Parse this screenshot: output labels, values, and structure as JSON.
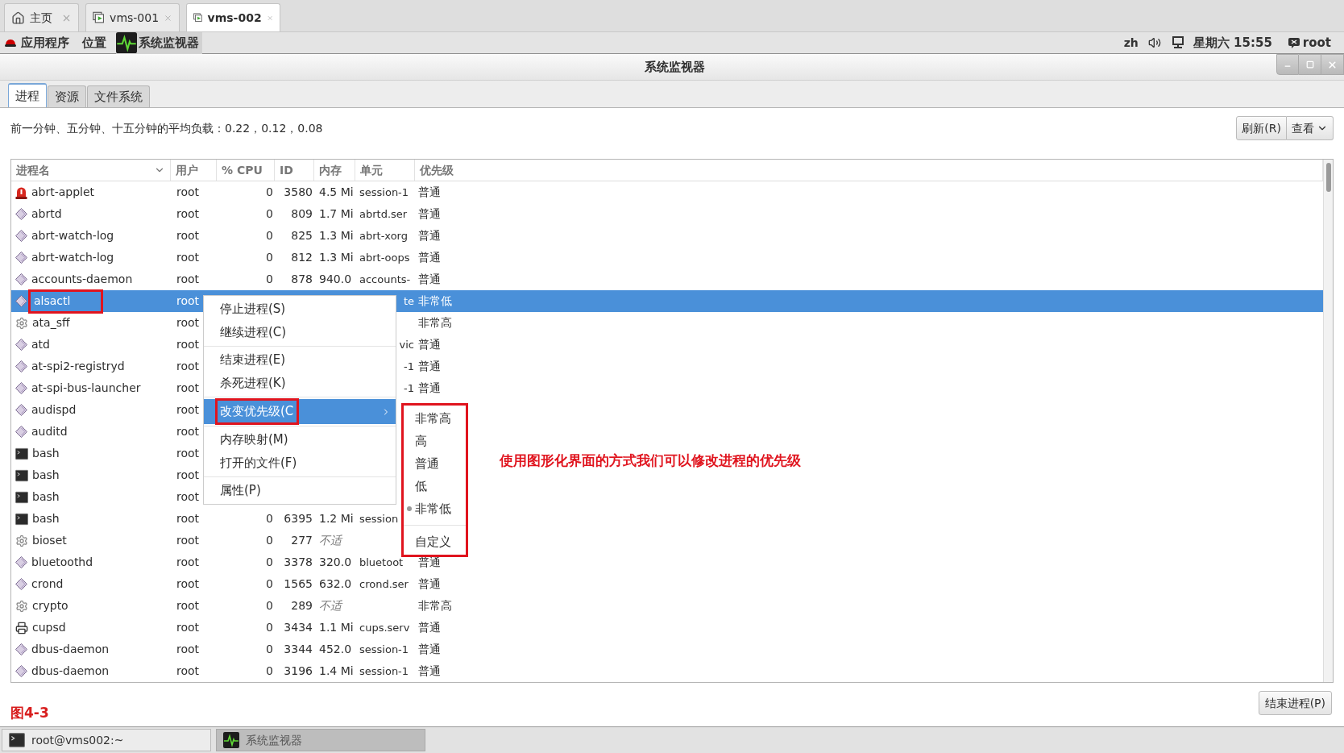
{
  "browser_tabs": [
    {
      "label": "主页",
      "kind": "home",
      "selected": false
    },
    {
      "label": "vms-001",
      "kind": "vm",
      "selected": false
    },
    {
      "label": "vms-002",
      "kind": "vm",
      "selected": true
    }
  ],
  "top_panel": {
    "applications": "应用程序",
    "places": "位置",
    "running_app": "系统监视器",
    "language": "zh",
    "clock": "星期六 15:55",
    "user": "root"
  },
  "window": {
    "title": "系统监视器"
  },
  "tabs": [
    {
      "label": "进程",
      "selected": true
    },
    {
      "label": "资源",
      "selected": false
    },
    {
      "label": "文件系统",
      "selected": false
    }
  ],
  "load_average": "前一分钟、五分钟、十五分钟的平均负载：0.22，0.12，0.08",
  "toolbar_buttons": [
    "刷新(R)",
    "查看"
  ],
  "table": {
    "columns": [
      "进程名",
      "用户",
      "% CPU",
      "ID",
      "内存",
      "单元",
      "优先级"
    ],
    "rows": [
      {
        "name": "abrt-applet",
        "kind": "alert",
        "user": "root",
        "cpu": "0",
        "id": "3580",
        "mem": "4.5 Mi",
        "unit": "session-1",
        "priority": "普通",
        "selected": false,
        "na": false,
        "highlighted": false
      },
      {
        "name": "abrtd",
        "kind": "diamond",
        "user": "root",
        "cpu": "0",
        "id": "809",
        "mem": "1.7 Mi",
        "unit": "abrtd.ser",
        "priority": "普通",
        "selected": false,
        "na": false,
        "highlighted": false
      },
      {
        "name": "abrt-watch-log",
        "kind": "diamond",
        "user": "root",
        "cpu": "0",
        "id": "825",
        "mem": "1.3 Mi",
        "unit": "abrt-xorg",
        "priority": "普通",
        "selected": false,
        "na": false,
        "highlighted": false
      },
      {
        "name": "abrt-watch-log",
        "kind": "diamond",
        "user": "root",
        "cpu": "0",
        "id": "812",
        "mem": "1.3 Mi",
        "unit": "abrt-oops",
        "priority": "普通",
        "selected": false,
        "na": false,
        "highlighted": false
      },
      {
        "name": "accounts-daemon",
        "kind": "diamond",
        "user": "root",
        "cpu": "0",
        "id": "878",
        "mem": "940.0",
        "unit": "accounts-",
        "priority": "普通",
        "selected": false,
        "na": false,
        "highlighted": false
      },
      {
        "name": "alsactl",
        "kind": "diamond",
        "user": "root",
        "unit": "te",
        "priority": "非常低",
        "selected": true,
        "highlighted": true
      },
      {
        "name": "ata_sff",
        "kind": "gear",
        "user": "root",
        "priority": "非常高",
        "selected": false,
        "highlighted": false
      },
      {
        "name": "atd",
        "kind": "diamond",
        "user": "root",
        "unit": "vic",
        "priority": "普通",
        "selected": false,
        "highlighted": false
      },
      {
        "name": "at-spi2-registryd",
        "kind": "diamond",
        "user": "root",
        "unit": "-1",
        "priority": "普通",
        "selected": false,
        "highlighted": false
      },
      {
        "name": "at-spi-bus-launcher",
        "kind": "diamond",
        "user": "root",
        "unit": "-1",
        "priority": "普通",
        "selected": false,
        "highlighted": false
      },
      {
        "name": "audispd",
        "kind": "diamond",
        "user": "root",
        "selected": false,
        "highlighted": false
      },
      {
        "name": "auditd",
        "kind": "diamond",
        "user": "root",
        "selected": false,
        "highlighted": false
      },
      {
        "name": "bash",
        "kind": "terminal",
        "user": "root",
        "selected": false,
        "highlighted": false
      },
      {
        "name": "bash",
        "kind": "terminal",
        "user": "root",
        "selected": false,
        "highlighted": false
      },
      {
        "name": "bash",
        "kind": "terminal",
        "user": "root",
        "selected": false,
        "highlighted": false
      },
      {
        "name": "bash",
        "kind": "terminal",
        "user": "root",
        "cpu": "0",
        "id": "6395",
        "mem": "1.2 Mi",
        "unit": "session",
        "selected": false,
        "na": false,
        "highlighted": false
      },
      {
        "name": "bioset",
        "kind": "gear",
        "user": "root",
        "cpu": "0",
        "id": "277",
        "mem": "不适",
        "selected": false,
        "na": true,
        "highlighted": false
      },
      {
        "name": "bluetoothd",
        "kind": "diamond",
        "user": "root",
        "cpu": "0",
        "id": "3378",
        "mem": "320.0",
        "unit": "bluetoot",
        "priority": "普通",
        "selected": false,
        "na": false,
        "highlighted": false
      },
      {
        "name": "crond",
        "kind": "diamond",
        "user": "root",
        "cpu": "0",
        "id": "1565",
        "mem": "632.0",
        "unit": "crond.ser",
        "priority": "普通",
        "selected": false,
        "na": false,
        "highlighted": false
      },
      {
        "name": "crypto",
        "kind": "gear",
        "user": "root",
        "cpu": "0",
        "id": "289",
        "mem": "不适",
        "priority": "非常高",
        "selected": false,
        "na": true,
        "highlighted": false
      },
      {
        "name": "cupsd",
        "kind": "printer",
        "user": "root",
        "cpu": "0",
        "id": "3434",
        "mem": "1.1 Mi",
        "unit": "cups.serv",
        "priority": "普通",
        "selected": false,
        "na": false,
        "highlighted": false
      },
      {
        "name": "dbus-daemon",
        "kind": "diamond",
        "user": "root",
        "cpu": "0",
        "id": "3344",
        "mem": "452.0",
        "unit": "session-1",
        "priority": "普通",
        "selected": false,
        "na": false,
        "highlighted": false
      },
      {
        "name": "dbus-daemon",
        "kind": "diamond",
        "user": "root",
        "cpu": "0",
        "id": "3196",
        "mem": "1.4 Mi",
        "unit": "session-1",
        "priority": "普通",
        "selected": false,
        "na": false,
        "highlighted": false
      }
    ]
  },
  "context_menu": {
    "groups": [
      [
        {
          "label": "停止进程(S)",
          "selected": false,
          "submenu": false,
          "highlighted": false
        },
        {
          "label": "继续进程(C)",
          "selected": false,
          "submenu": false,
          "highlighted": false
        }
      ],
      [
        {
          "label": "结束进程(E)",
          "selected": false,
          "submenu": false,
          "highlighted": false
        },
        {
          "label": "杀死进程(K)",
          "selected": false,
          "submenu": false,
          "highlighted": false
        }
      ],
      [
        {
          "label": "改变优先级(C",
          "selected": true,
          "submenu": true,
          "highlighted": true
        }
      ],
      [
        {
          "label": "内存映射(M)",
          "selected": false,
          "submenu": false,
          "highlighted": false
        },
        {
          "label": "打开的文件(F)",
          "selected": false,
          "submenu": false,
          "highlighted": false
        }
      ],
      [
        {
          "label": "属性(P)",
          "selected": false,
          "submenu": false,
          "highlighted": false
        }
      ]
    ]
  },
  "priority_submenu": {
    "highlighted": true,
    "groups": [
      [
        {
          "label": "非常高",
          "selected": false
        },
        {
          "label": "高",
          "selected": false
        },
        {
          "label": "普通",
          "selected": false
        },
        {
          "label": "低",
          "selected": false
        },
        {
          "label": "非常低",
          "selected": true
        }
      ],
      [
        {
          "label": "自定义",
          "selected": false
        }
      ]
    ]
  },
  "annotation": "使用图形化界面的方式我们可以修改进程的优先级",
  "figure_label": "图4-3",
  "end_process_button": "结束进程(P)",
  "taskbar": [
    {
      "label": "root@vms002:~",
      "kind": "terminal",
      "selected": false
    },
    {
      "label": "系统监视器",
      "kind": "monitor",
      "selected": true
    }
  ]
}
